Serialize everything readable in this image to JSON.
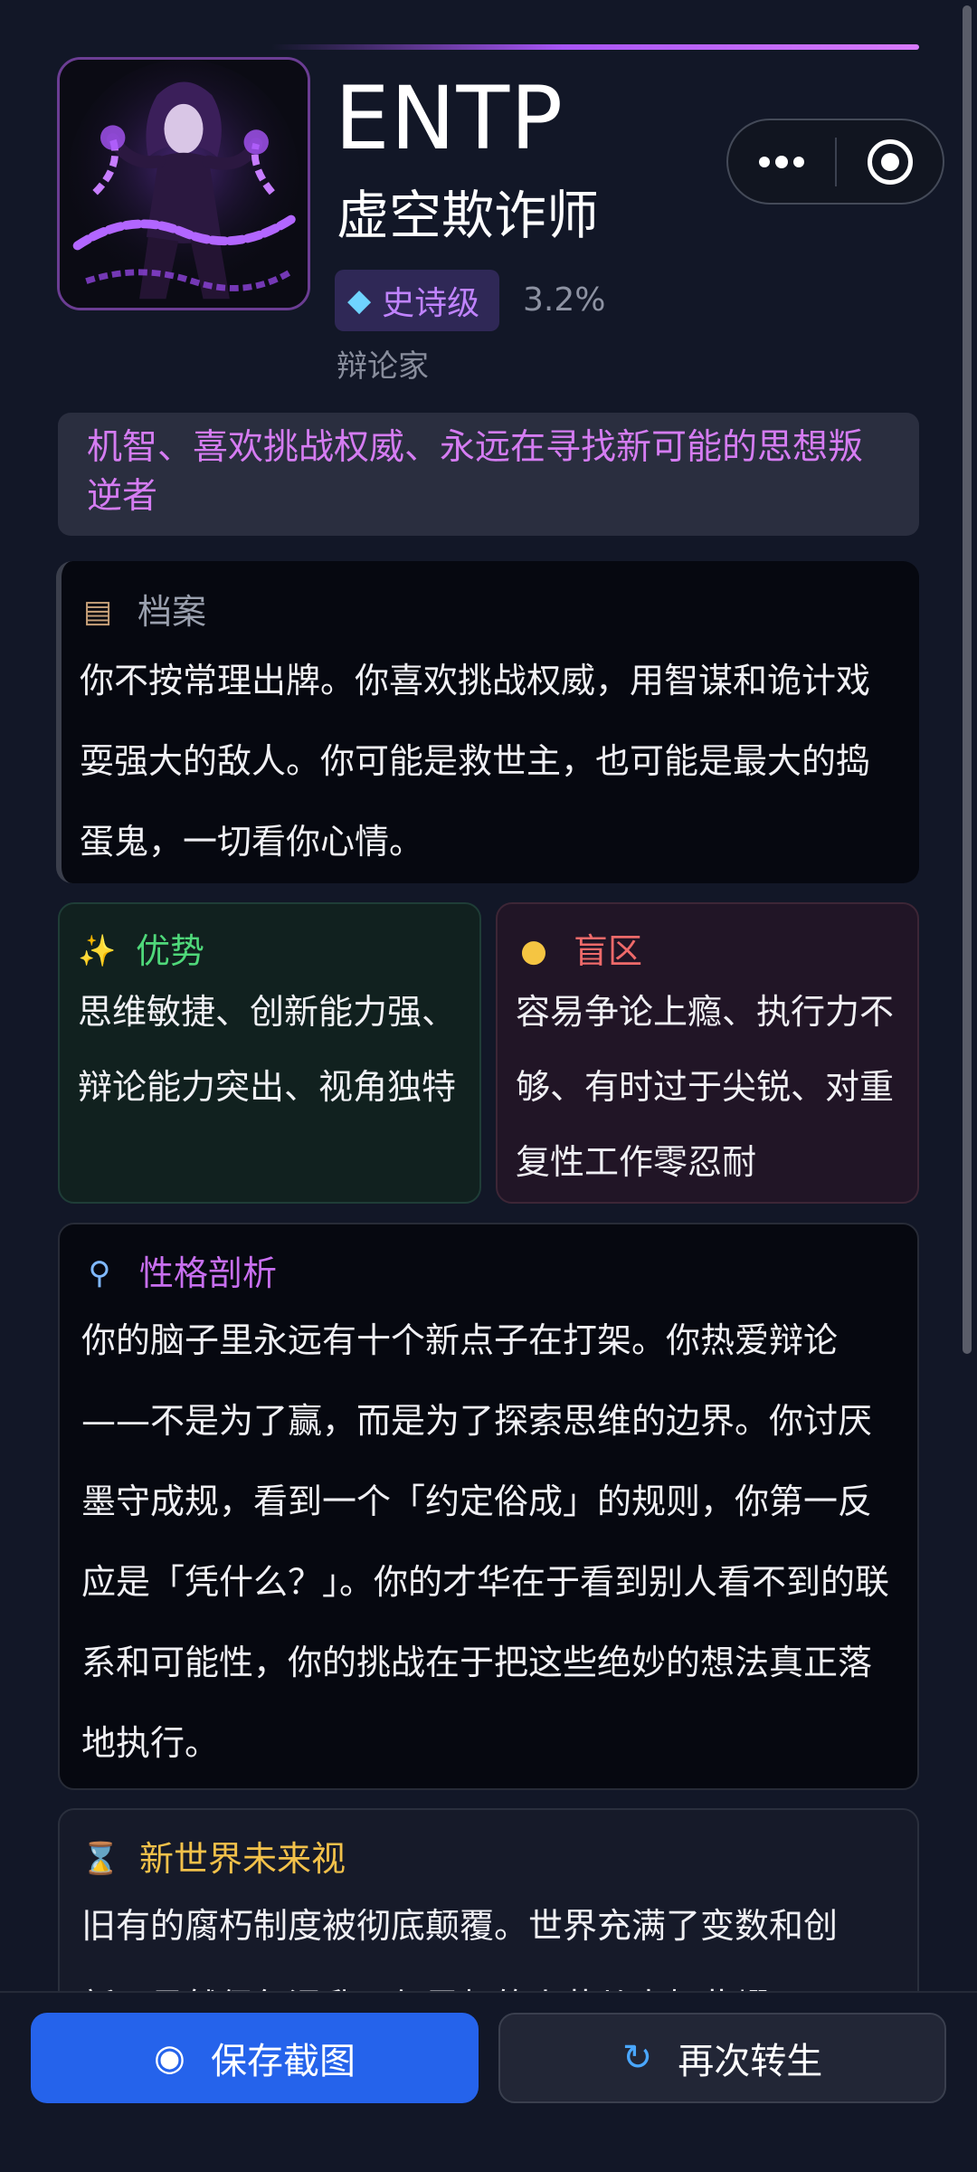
{
  "header": {
    "type_code": "ENTP",
    "type_name": "虚空欺诈师",
    "rarity_label": "史诗级",
    "rarity_icon": "gem-icon",
    "rarity_percent": "3.2%",
    "subtitle": "辩论家"
  },
  "tagline": "机智、喜欢挑战权威、永远在寻找新可能的思想叛逆者",
  "dossier": {
    "icon": "clipboard-icon",
    "title": "档案",
    "body": "你不按常理出牌。你喜欢挑战权威，用智谋和诡计戏耍强大的敌人。你可能是救世主，也可能是最大的捣蛋鬼，一切看你心情。"
  },
  "strengths": {
    "icon": "sparkles-icon",
    "title": "优势",
    "body": "思维敏捷、创新能力强、辩论能力突出、视角独特"
  },
  "blind_spots": {
    "icon": "lightbulb-icon",
    "title": "盲区",
    "body": "容易争论上瘾、执行力不够、有时过于尖锐、对重复性工作零忍耐"
  },
  "analysis": {
    "icon": "magnifier-icon",
    "title": "性格剖析",
    "body": "你的脑子里永远有十个新点子在打架。你热爱辩论——不是为了赢，而是为了探索思维的边界。你讨厌墨守成规，看到一个「约定俗成」的规则，你第一反应是「凭什么？」。你的才华在于看到别人看不到的联系和可能性，你的挑战在于把这些绝妙的想法真正落地执行。"
  },
  "future": {
    "icon": "hourglass-icon",
    "title": "新世界未来视",
    "body": "旧有的腐朽制度被彻底颠覆。世界充满了变数和创新，虽然偶尔混乱，但思想的火花从未如此耀"
  },
  "actions": {
    "save_icon": "camera-flash-icon",
    "save_label": "保存截图",
    "retry_icon": "refresh-icon",
    "retry_label": "再次转生"
  },
  "colors": {
    "accent": "#a855f7",
    "primary_button": "#2563eb",
    "strength": "#4fd87a",
    "blind_spot": "#ef6a6a",
    "analysis": "#c86ff0",
    "future": "#f2c14a"
  }
}
